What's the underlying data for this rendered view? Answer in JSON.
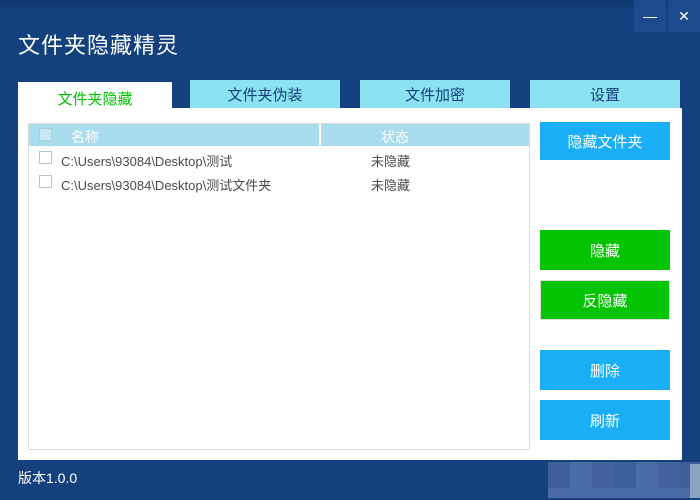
{
  "window": {
    "title": "文件夹隐藏精灵",
    "minimize_label": "—",
    "close_label": "✕"
  },
  "tabs": [
    {
      "label": "文件夹隐藏",
      "active": true
    },
    {
      "label": "文件夹伪装",
      "active": false
    },
    {
      "label": "文件加密",
      "active": false
    },
    {
      "label": "设置",
      "active": false
    }
  ],
  "table": {
    "headers": {
      "name": "名称",
      "status": "状态"
    },
    "rows": [
      {
        "path": "C:\\Users\\93084\\Desktop\\测试",
        "status": "未隐藏",
        "checked": false
      },
      {
        "path": "C:\\Users\\93084\\Desktop\\测试文件夹",
        "status": "未隐藏",
        "checked": false
      }
    ]
  },
  "buttons": {
    "hide_folder": "隐藏文件夹",
    "hide": "隐藏",
    "unhide": "反隐藏",
    "delete": "删除",
    "refresh": "刷新"
  },
  "footer": {
    "version": "版本1.0.0"
  },
  "colors": {
    "window_bg": "#14417E",
    "tab_inactive_bg": "#8CE2F0",
    "tab_active_text": "#00C300",
    "table_header_bg": "#A9DCEC",
    "button_blue": "#19AEF6",
    "button_green": "#04C404"
  }
}
